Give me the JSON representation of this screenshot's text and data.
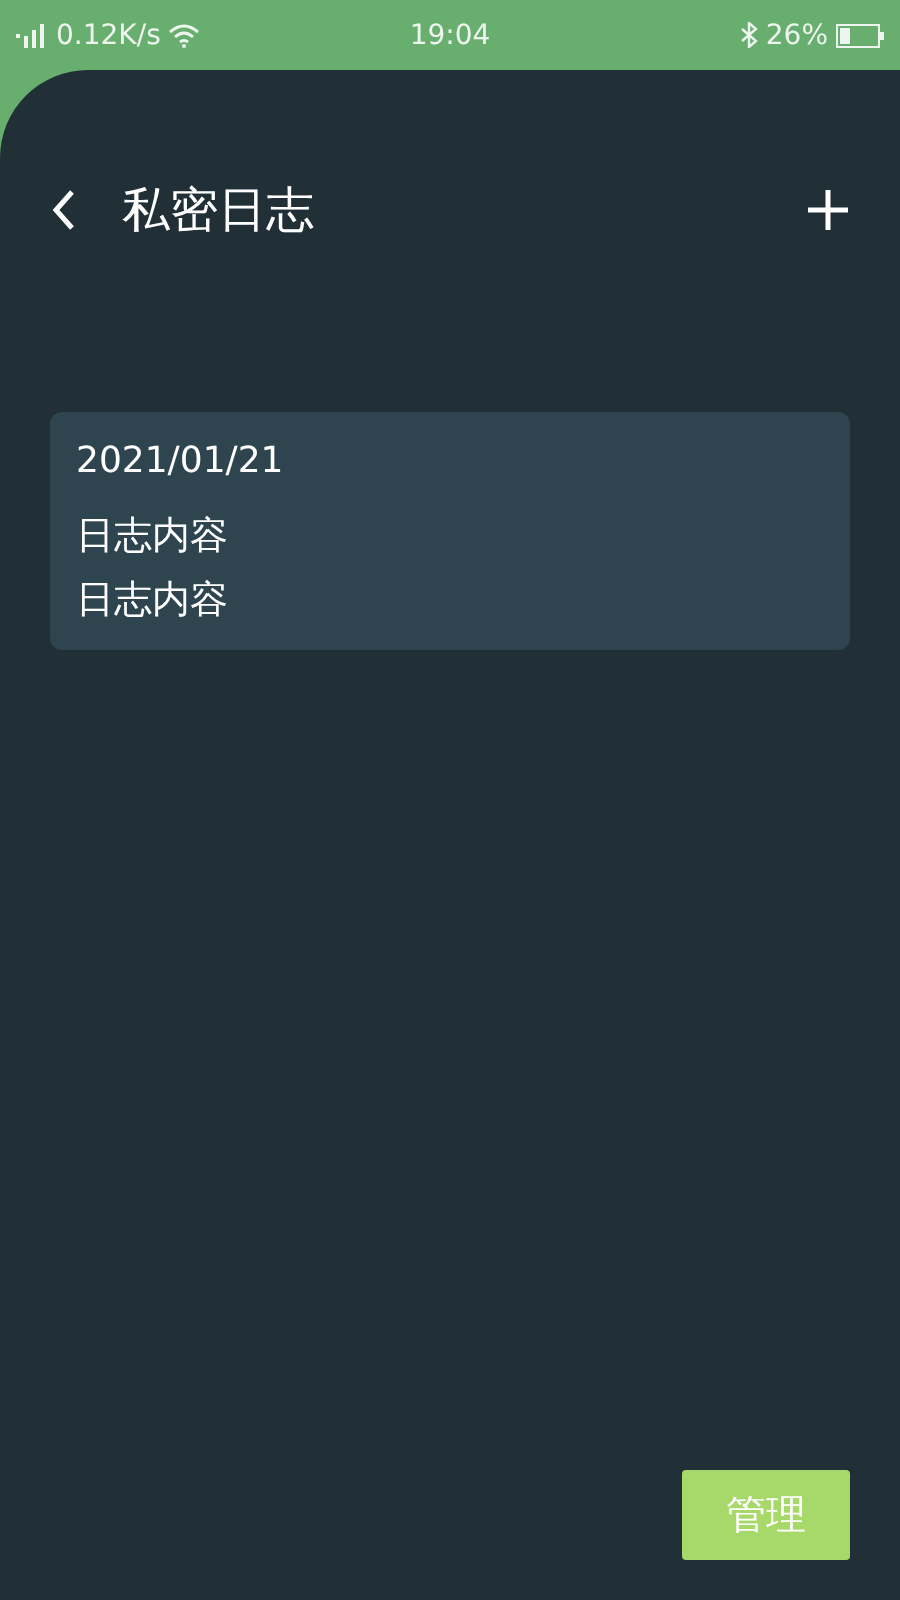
{
  "status_bar": {
    "speed": "0.12K/s",
    "time": "19:04",
    "battery": "26%"
  },
  "header": {
    "title": "私密日志"
  },
  "entries": [
    {
      "date": "2021/01/21",
      "lines": [
        "日志内容",
        "日志内容"
      ]
    }
  ],
  "manage_button": "管理"
}
